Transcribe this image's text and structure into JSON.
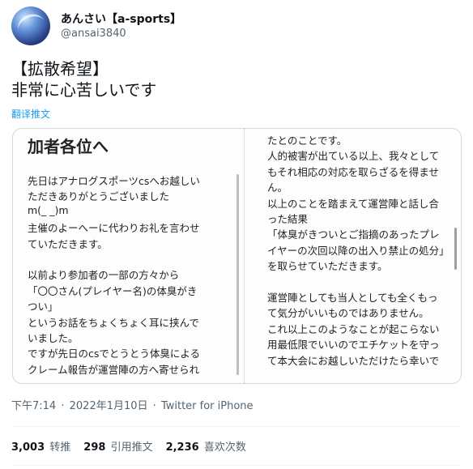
{
  "author": {
    "display_name": "あんさい【a-sports】",
    "handle": "@ansai3840",
    "avatar_icon": "avatar-image"
  },
  "tweet": {
    "lines": [
      "【拡散希望】",
      "非常に心苦しいです"
    ],
    "translate_label": "翻译推文"
  },
  "image": {
    "heading": "加者各位へ",
    "left_lines": [
      "先日はアナログスポーツcsへお越しい",
      "ただきありがとうございました",
      "m(_ _)m",
      "主催のよーへーに代わりお礼を言わせ",
      "ていただきます。",
      "",
      "以前より参加者の一部の方々から",
      "「〇〇さん(プレイヤー名)の体臭がき",
      "つい」",
      "というお話をちょくちょく耳に挟んで",
      "いました。",
      "ですが先日のcsでとうとう体臭による",
      "クレーム報告が運営陣の方へ寄せられ"
    ],
    "right_lines": [
      "たとのことです。",
      "人的被害が出ている以上、我々として",
      "もそれ相応の対応を取らざるを得ませ",
      "ん。",
      "以上のことを踏まえて運営陣と話し合",
      "った結果",
      "「体臭がきついとご指摘のあったプレ",
      "イヤーの次回以降の出入り禁止の処分」",
      "を取らせていただきます。",
      "",
      "運営陣としても当人としても全くもっ",
      "て気分がいいものではありません。",
      "これ以上このようなことが起こらない",
      "用最低限でいいのでエチケットを守っ",
      "て本大会にお越しいただけたら幸いで"
    ]
  },
  "meta": {
    "time": "下午7:14",
    "date": "2022年1月10日",
    "source": "Twitter for iPhone",
    "separator": "·"
  },
  "stats": {
    "retweets": {
      "count": "3,003",
      "label": "转推"
    },
    "quotes": {
      "count": "298",
      "label": "引用推文"
    },
    "likes": {
      "count": "2,236",
      "label": "喜欢次数"
    }
  }
}
